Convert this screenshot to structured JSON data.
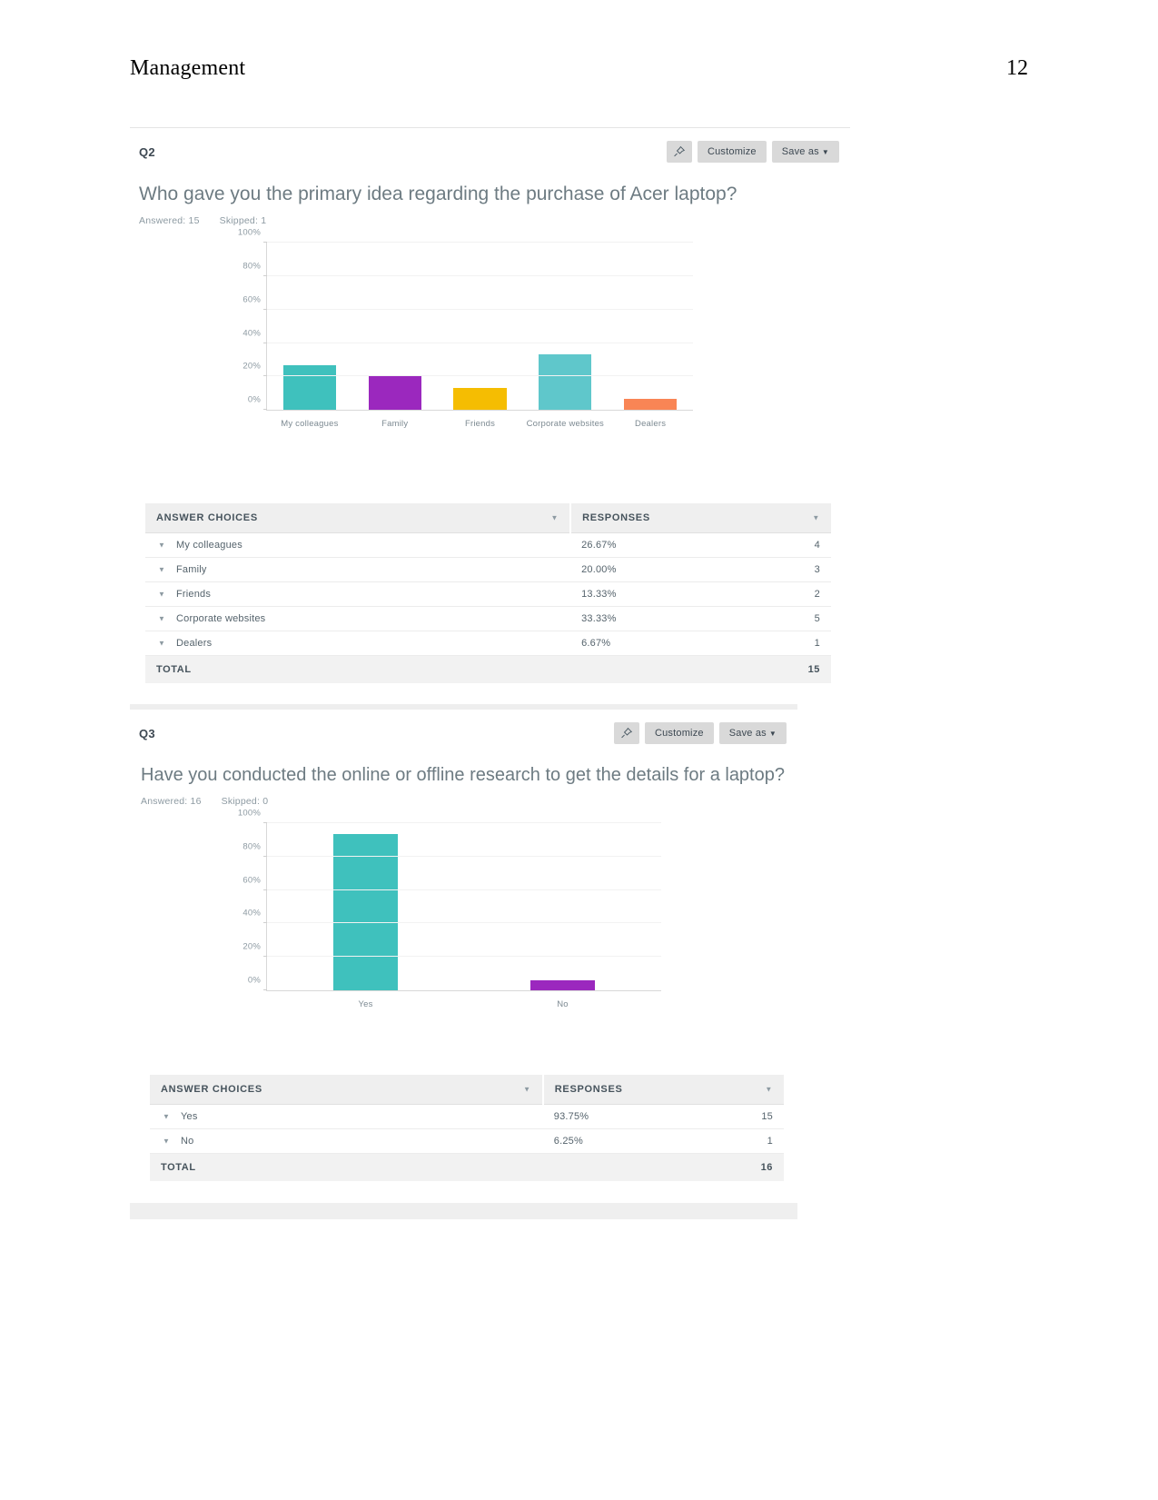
{
  "document": {
    "header_title": "Management",
    "page_number": "12"
  },
  "blocks": [
    {
      "id": "q2",
      "question_label": "Q2",
      "actions": {
        "pin_icon": "pin-icon",
        "customize_label": "Customize",
        "save_as_label": "Save as",
        "save_as_caret": "▼"
      },
      "question_text": "Who gave you the primary idea regarding the purchase of Acer laptop?",
      "meta": {
        "answered": "Answered: 15",
        "skipped": "Skipped: 1"
      },
      "table": {
        "col_choices": "ANSWER CHOICES",
        "col_responses": "RESPONSES",
        "header_caret": "▼",
        "row_caret": "▼",
        "rows": [
          {
            "choice": "My colleagues",
            "percent": "26.67%",
            "count": "4"
          },
          {
            "choice": "Family",
            "percent": "20.00%",
            "count": "3"
          },
          {
            "choice": "Friends",
            "percent": "13.33%",
            "count": "2"
          },
          {
            "choice": "Corporate websites",
            "percent": "33.33%",
            "count": "5"
          },
          {
            "choice": "Dealers",
            "percent": "6.67%",
            "count": "1"
          }
        ],
        "total_label": "TOTAL",
        "total_value": "15"
      }
    },
    {
      "id": "q3",
      "question_label": "Q3",
      "actions": {
        "pin_icon": "pin-icon",
        "customize_label": "Customize",
        "save_as_label": "Save as",
        "save_as_caret": "▼"
      },
      "question_text": "Have you conducted the online or offline research to get the details for a laptop?",
      "meta": {
        "answered": "Answered: 16",
        "skipped": "Skipped: 0"
      },
      "table": {
        "col_choices": "ANSWER CHOICES",
        "col_responses": "RESPONSES",
        "header_caret": "▼",
        "row_caret": "▼",
        "rows": [
          {
            "choice": "Yes",
            "percent": "93.75%",
            "count": "15"
          },
          {
            "choice": "No",
            "percent": "6.25%",
            "count": "1"
          }
        ],
        "total_label": "TOTAL",
        "total_value": "16"
      }
    }
  ],
  "chart_data": [
    {
      "type": "bar",
      "id": "q2-chart",
      "title": "Who gave you the primary idea regarding the purchase of Acer laptop?",
      "xlabel": "",
      "ylabel": "",
      "categories": [
        "My colleagues",
        "Family",
        "Friends",
        "Corporate websites",
        "Dealers"
      ],
      "values": [
        26.67,
        20.0,
        13.33,
        33.33,
        6.67
      ],
      "counts": [
        4,
        3,
        2,
        5,
        1
      ],
      "colors": [
        "#3fc1bd",
        "#9b28be",
        "#f5bd02",
        "#5fc7cb",
        "#f98555"
      ],
      "ylim": [
        0,
        100
      ],
      "yticks": [
        "0%",
        "20%",
        "40%",
        "60%",
        "80%",
        "100%"
      ],
      "ytick_values": [
        0,
        20,
        40,
        60,
        80,
        100
      ],
      "grid": true,
      "legend": "none"
    },
    {
      "type": "bar",
      "id": "q3-chart",
      "title": "Have you conducted the online or offline research to get the details for a laptop?",
      "xlabel": "",
      "ylabel": "",
      "categories": [
        "Yes",
        "No"
      ],
      "values": [
        93.75,
        6.25
      ],
      "counts": [
        15,
        1
      ],
      "colors": [
        "#3fc1bd",
        "#9b28be"
      ],
      "ylim": [
        0,
        100
      ],
      "yticks": [
        "0%",
        "20%",
        "40%",
        "60%",
        "80%",
        "100%"
      ],
      "ytick_values": [
        0,
        20,
        40,
        60,
        80,
        100
      ],
      "grid": true,
      "legend": "none"
    }
  ]
}
